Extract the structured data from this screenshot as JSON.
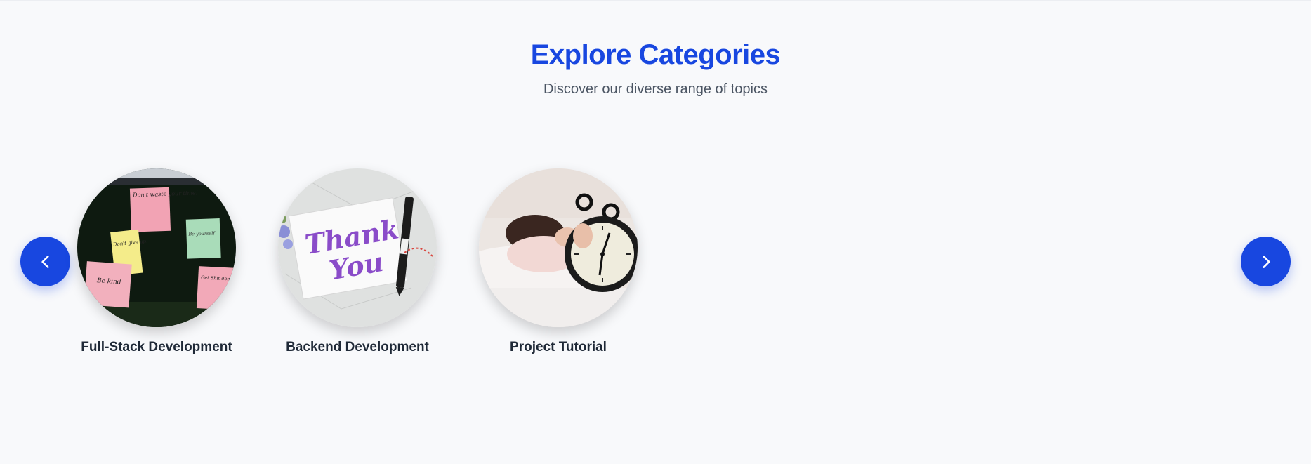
{
  "header": {
    "title": "Explore Categories",
    "subtitle": "Discover our diverse range of topics"
  },
  "carousel": {
    "prev_icon": "chevron-left-icon",
    "next_icon": "chevron-right-icon",
    "accent_color": "#1847e0",
    "categories": [
      {
        "label": "Full-Stack Development",
        "image": "sticky-notes-board",
        "notes": [
          "Don't waste your time!",
          "Don't give up!",
          "Be yourself",
          "Be kind",
          "Get Shit done"
        ]
      },
      {
        "label": "Backend Development",
        "image": "thank-you-card",
        "card_text": [
          "Thank",
          "You"
        ]
      },
      {
        "label": "Project Tutorial",
        "image": "alarm-clock-bed"
      }
    ]
  }
}
